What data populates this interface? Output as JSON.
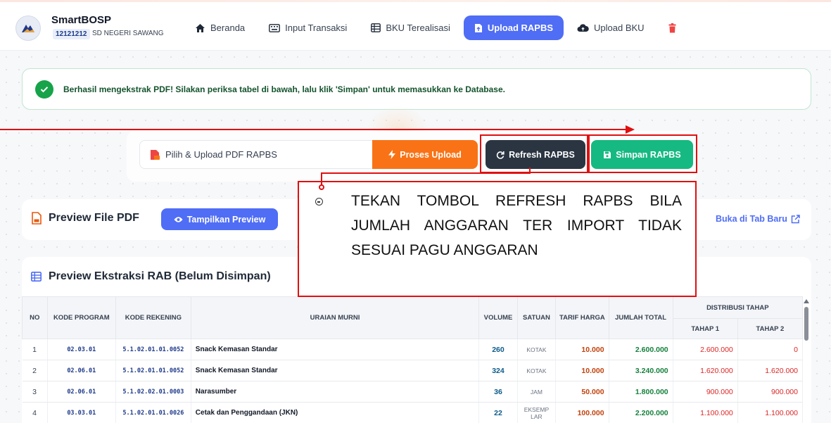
{
  "app": {
    "title": "SmartBOSP",
    "school_code": "12121212",
    "school_name": "SD NEGERI SAWANG"
  },
  "nav": {
    "items": [
      {
        "label": "Beranda",
        "icon": "home-icon",
        "active": false
      },
      {
        "label": "Input Transaksi",
        "icon": "keyboard-icon",
        "active": false
      },
      {
        "label": "BKU Terealisasi",
        "icon": "table-icon",
        "active": false
      },
      {
        "label": "Upload RAPBS",
        "icon": "file-upload-icon",
        "active": true
      },
      {
        "label": "Upload BKU",
        "icon": "cloud-upload-icon",
        "active": false
      }
    ]
  },
  "banner": {
    "message": "Berhasil mengekstrak PDF! Silakan periksa tabel di bawah, lalu klik 'Simpan' untuk memasukkan ke Database."
  },
  "upload": {
    "file_label": "Pilih & Upload PDF RAPBS",
    "proses_label": "Proses Upload",
    "refresh_label": "Refresh RAPBS",
    "simpan_label": "Simpan RAPBS"
  },
  "annotation": {
    "note": "TEKAN TOMBOL REFRESH RAPBS BILA JUMLAH ANGGARAN TER IMPORT TIDAK SESUAI PAGU ANGGARAN"
  },
  "pdf_preview": {
    "title": "Preview File PDF",
    "show_label": "Tampilkan Preview",
    "open_tab_label": "Buka di Tab Baru"
  },
  "rab": {
    "title": "Preview Ekstraksi RAB (Belum Disimpan)",
    "headers": {
      "no": "NO",
      "kode_program": "KODE PROGRAM",
      "kode_rekening": "KODE REKENING",
      "uraian": "URAIAN MURNI",
      "volume": "VOLUME",
      "satuan": "SATUAN",
      "tarif": "TARIF HARGA",
      "jumlah": "JUMLAH TOTAL",
      "distribusi": "DISTRIBUSI TAHAP",
      "tahap1": "TAHAP 1",
      "tahap2": "TAHAP 2"
    },
    "rows": [
      {
        "no": "1",
        "kode_program": "02.03.01",
        "kode_rekening": "5.1.02.01.01.0052",
        "uraian": "Snack Kemasan Standar",
        "volume": "260",
        "satuan": "KOTAK",
        "tarif": "10.000",
        "jumlah": "2.600.000",
        "tahap1": "2.600.000",
        "tahap2": "0"
      },
      {
        "no": "2",
        "kode_program": "02.06.01",
        "kode_rekening": "5.1.02.01.01.0052",
        "uraian": "Snack Kemasan Standar",
        "volume": "324",
        "satuan": "KOTAK",
        "tarif": "10.000",
        "jumlah": "3.240.000",
        "tahap1": "1.620.000",
        "tahap2": "1.620.000"
      },
      {
        "no": "3",
        "kode_program": "02.06.01",
        "kode_rekening": "5.1.02.02.01.0003",
        "uraian": "Narasumber",
        "volume": "36",
        "satuan": "JAM",
        "tarif": "50.000",
        "jumlah": "1.800.000",
        "tahap1": "900.000",
        "tahap2": "900.000"
      },
      {
        "no": "4",
        "kode_program": "03.03.01",
        "kode_rekening": "5.1.02.01.01.0026",
        "uraian": "Cetak dan Penggandaan (JKN)",
        "volume": "22",
        "satuan": "EKSEMP LAR",
        "tarif": "100.000",
        "jumlah": "2.200.000",
        "tahap1": "1.100.000",
        "tahap2": "1.100.000"
      }
    ]
  },
  "colors": {
    "primary": "#4f6df5",
    "orange": "#f97316",
    "dark": "#2b3542",
    "green": "#16b981",
    "annotation_red": "#e01010"
  }
}
